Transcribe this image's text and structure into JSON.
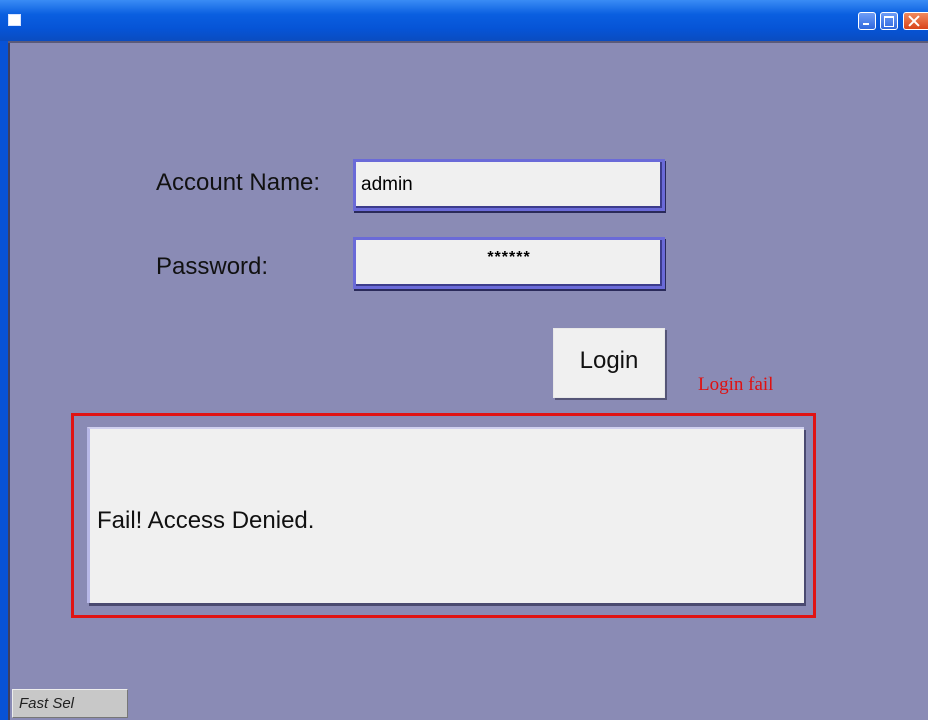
{
  "window": {
    "icon": "window-app-icon",
    "controls": {
      "minimize_icon": "minimize-icon",
      "maximize_icon": "maximize-icon",
      "close_icon": "close-icon"
    }
  },
  "form": {
    "account_label": "Account Name:",
    "account_value": "admin",
    "password_label": "Password:",
    "password_value": "******",
    "login_label": "Login"
  },
  "annotation": {
    "text": "Login fail",
    "color": "#e01010"
  },
  "message": {
    "text": "Fail! Access Denied."
  },
  "status": {
    "label": "Fast Sel"
  },
  "colors": {
    "background": "#8a8bb5",
    "titlebar": "#0654d6",
    "highlight": "#e01414"
  }
}
